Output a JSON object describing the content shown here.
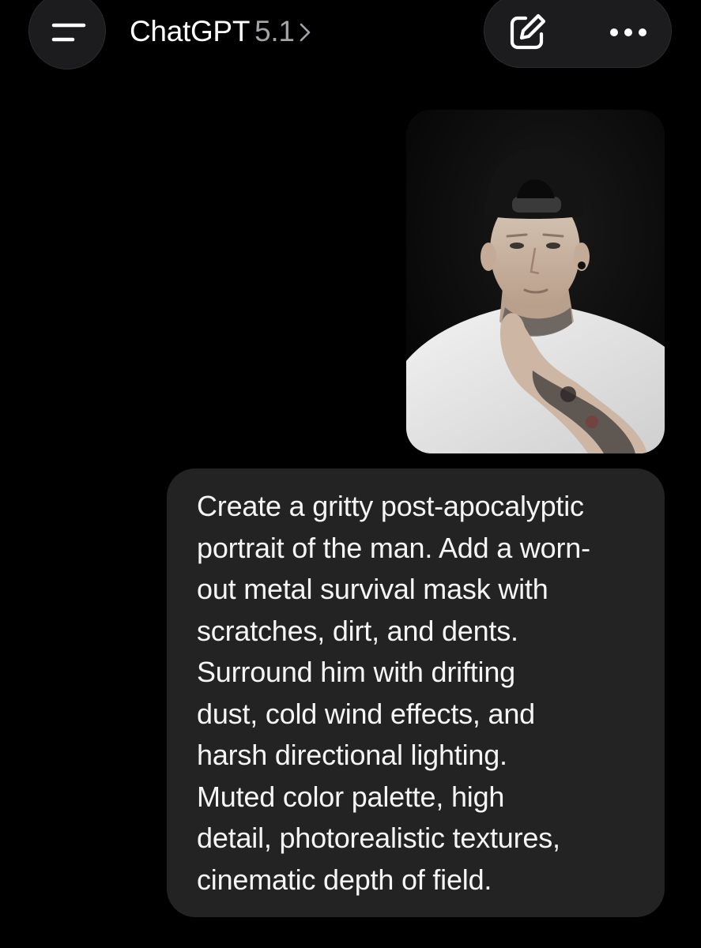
{
  "header": {
    "model_name": "ChatGPT",
    "model_version": "5.1",
    "menu_icon": "hamburger-icon",
    "compose_icon": "compose-icon",
    "more_icon": "ellipsis-icon",
    "chevron_icon": "chevron-right-icon"
  },
  "conversation": {
    "user_image": {
      "subject": "photo"
    },
    "user_message": {
      "lines": [
        "Create a gritty post-apocalyptic",
        "portrait of the man. Add a worn-",
        "out metal survival mask with",
        "scratches, dirt, and dents.",
        "Surround him with drifting",
        "dust, cold wind effects, and",
        "harsh directional lighting.",
        "Muted color palette, high",
        "detail, photorealistic textures,",
        "cinematic depth of field."
      ]
    }
  },
  "colors": {
    "background": "#000000",
    "bubble": "#232323",
    "header_control": "#1c1c1e",
    "secondary_text": "#a3a3a8"
  }
}
